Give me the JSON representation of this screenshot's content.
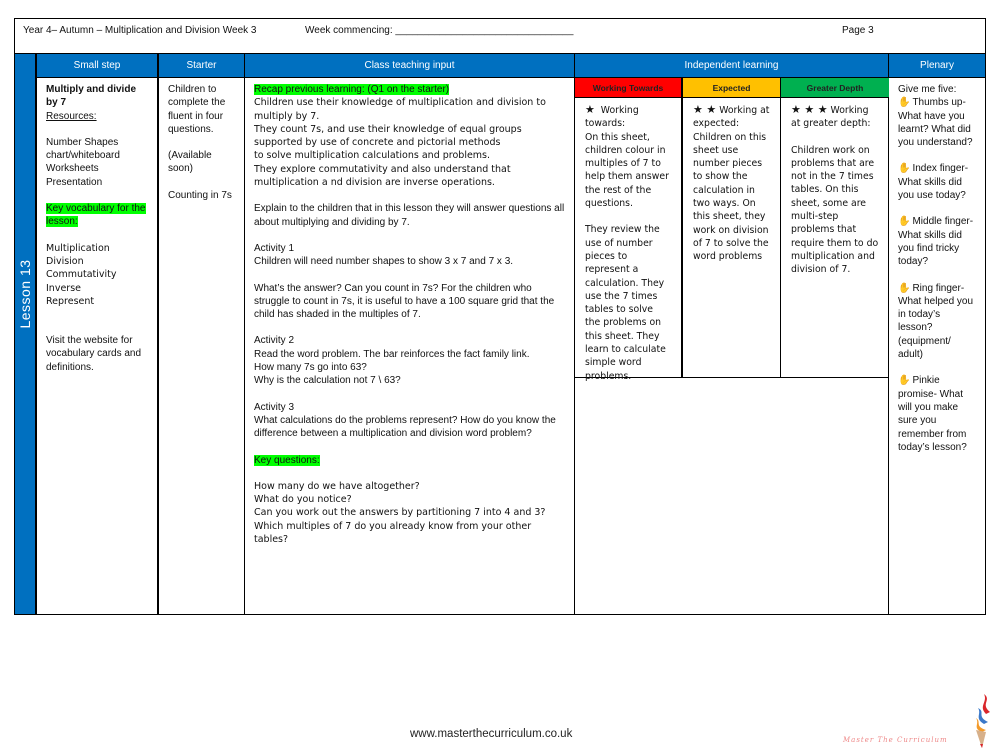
{
  "header": {
    "title": "Year 4– Autumn – Multiplication and Division Week 3",
    "week_commencing": "Week commencing: ________________________________",
    "page": "Page 3"
  },
  "lesson_label": "Lesson 13",
  "columns": {
    "small_step": "Small step",
    "starter": "Starter",
    "class_teaching": "Class teaching input",
    "independent": "Independent learning",
    "plenary": "Plenary"
  },
  "small_step": {
    "title": "Multiply and divide by 7",
    "resources_label": "Resources:",
    "resources": [
      "Number Shapes",
      "chart/whiteboard",
      "Worksheets",
      "Presentation"
    ],
    "vocab_label": "Key vocabulary for the lesson:",
    "vocab": [
      "Multiplication",
      "Division",
      "Commutativity",
      "Inverse",
      "Represent"
    ],
    "website_note": "Visit the website for vocabulary cards and definitions."
  },
  "starter": {
    "line1": "Children to complete the fluent in four questions.",
    "line2": "(Available soon)",
    "line3": "Counting in 7s"
  },
  "teaching": {
    "recap_label": "Recap previous learning: (Q1 on the starter)",
    "recap_lines": [
      "Children use their knowledge of multiplication and division to multiply by 7.",
      "They count 7s, and use their knowledge of equal groups supported by use of concrete and pictorial methods",
      "to solve multiplication calculations and problems.",
      "They explore commutativity and also understand that multiplication a nd division are inverse operations."
    ],
    "intro": "Explain to the children that in this lesson they will answer questions all about multiplying and dividing by 7.",
    "activity1_title": "Activity 1",
    "activity1_text": "Children will need number shapes to show 3 x 7 and 7 x 3.",
    "activity1_q": "What’s the answer? Can you count in 7s? For the children who struggle to count in 7s, it is useful to have a 100 square grid that the child has shaded in the multiples of 7.",
    "activity2_title": "Activity 2",
    "activity2_lines": [
      "Read the word problem. The bar reinforces the fact family link.",
      "How many 7s go into 63?",
      "Why is the calculation not 7 \\ 63?"
    ],
    "activity3_title": "Activity 3",
    "activity3_text": "What calculations do the problems represent? How do you know the difference between a multiplication and division word problem?",
    "key_questions_label": "Key questions:",
    "key_questions": [
      "How many do we have altogether?",
      "What do you notice?",
      "Can you work out the answers by partitioning 7 into 4 and 3?",
      "Which multiples of 7 do you already know from your other tables?"
    ]
  },
  "independent": {
    "working_towards": {
      "label": "Working Towards",
      "color": "#ff0000",
      "stars": "★",
      "heading": "Working towards:",
      "text1": "On this sheet, children colour in multiples of 7 to help them answer the rest of the questions.",
      "text2": "They review the use of number pieces to represent a calculation. They use the 7 times tables to solve the problems on this sheet. They learn to calculate simple word problems."
    },
    "expected": {
      "label": "Expected",
      "color": "#ffc000",
      "stars": "★ ★",
      "heading": "Working at expected:",
      "text1": "Children on this sheet use number pieces to show the calculation in two ways. On this sheet, they work on division of 7 to solve the word problems"
    },
    "greater_depth": {
      "label": "Greater Depth",
      "color": "#00b050",
      "stars": "★ ★ ★",
      "heading": "Working at greater depth:",
      "text1": "Children work on problems that are not in the 7 times tables. On this sheet, some are multi-step problems that require them to do multiplication and division of 7."
    }
  },
  "plenary": {
    "intro": "Give me five:",
    "items": [
      "Thumbs up- What have you learnt? What did you understand?",
      "Index finger- What skills did you use today?",
      "Middle finger- What skills did you find tricky today?",
      "Ring finger- What helped you in today’s lesson? (equipment/ adult)",
      "Pinkie promise- What will you make sure you remember from today’s lesson?"
    ]
  },
  "footer": {
    "url": "www.masterthecurriculum.co.uk",
    "logo_text": "Master The Curriculum"
  },
  "colors": {
    "header_blue": "#0070c0",
    "highlight_green": "#00ff00"
  }
}
